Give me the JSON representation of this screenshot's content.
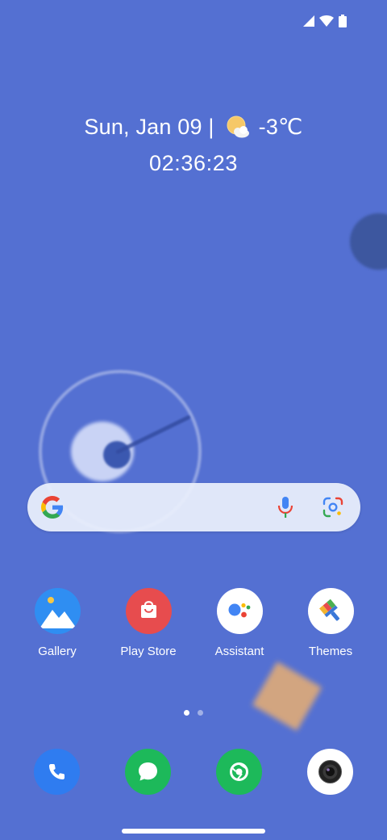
{
  "statusbar": {
    "signal_icon": "cell-signal-icon",
    "wifi_icon": "wifi-icon",
    "battery_icon": "battery-icon"
  },
  "clock_widget": {
    "date": "Sun, Jan 09 |",
    "weather_icon": "partly-sunny-icon",
    "temperature": "-3℃",
    "time": "02:36:23"
  },
  "search_bar": {
    "logo_icon": "google-g-icon",
    "voice_icon": "microphone-icon",
    "lens_icon": "lens-icon"
  },
  "home_apps": [
    {
      "label": "Gallery",
      "icon": "gallery-icon"
    },
    {
      "label": "Play Store",
      "icon": "play-store-icon"
    },
    {
      "label": "Assistant",
      "icon": "assistant-icon"
    },
    {
      "label": "Themes",
      "icon": "themes-icon"
    }
  ],
  "page_indicator": {
    "pages": 2,
    "current": 1
  },
  "dock": [
    {
      "icon": "phone-icon"
    },
    {
      "icon": "messages-icon"
    },
    {
      "icon": "chrome-icon"
    },
    {
      "icon": "camera-icon"
    }
  ],
  "colors": {
    "wallpaper": "#5470d2",
    "gallery": "#2f8ef2",
    "play_store": "#e74c4e",
    "phone": "#2f7cf0",
    "messages": "#1db95a",
    "chrome": "#1db95a"
  }
}
